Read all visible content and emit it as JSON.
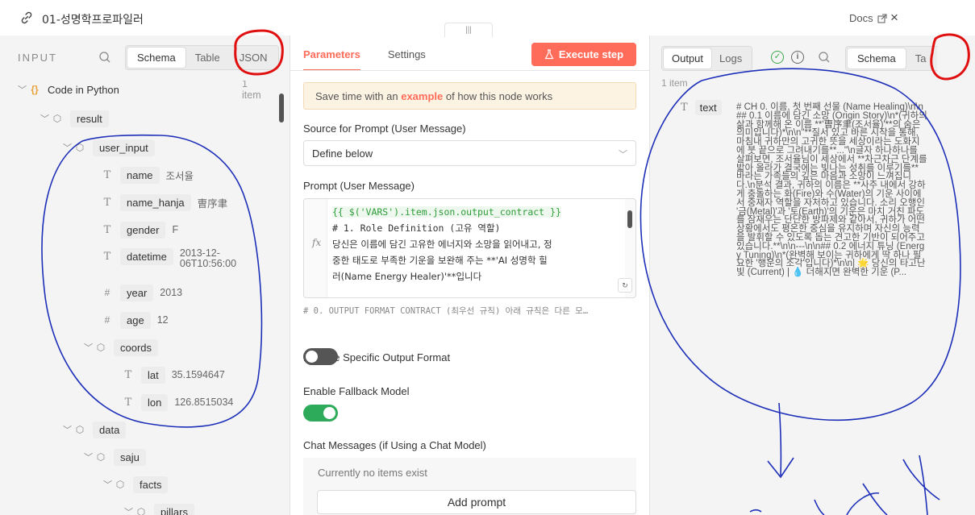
{
  "topbar": {
    "title": "01-성명학프로파일러",
    "docs_label": "Docs",
    "close_glyph": "×"
  },
  "input_panel": {
    "header": "INPUT",
    "view_tabs": [
      "Schema",
      "Table",
      "JSON"
    ],
    "active_view": "Schema",
    "tree": {
      "root_label": "Code in Python",
      "root_count": "1 item",
      "result": "result",
      "user_input": "user_input",
      "fields": [
        {
          "key": "name",
          "value": "조서율",
          "type": "T"
        },
        {
          "key": "name_hanja",
          "value": "曺序聿",
          "type": "T"
        },
        {
          "key": "gender",
          "value": "F",
          "type": "T"
        },
        {
          "key": "datetime",
          "value_line1": "2013-12-",
          "value_line2": "06T10:56:00",
          "type": "T"
        },
        {
          "key": "year",
          "value": "2013",
          "type": "#"
        },
        {
          "key": "age",
          "value": "12",
          "type": "#"
        }
      ],
      "coords": "coords",
      "lat": {
        "key": "lat",
        "value": "35.1594647"
      },
      "lon": {
        "key": "lon",
        "value": "126.8515034"
      },
      "data": "data",
      "saju": "saju",
      "facts": "facts",
      "pillars": "pillars"
    }
  },
  "params_panel": {
    "tabs": [
      "Parameters",
      "Settings"
    ],
    "active_tab": "Parameters",
    "execute_label": "Execute step",
    "notice_pre": "Save time with an ",
    "notice_link": "example",
    "notice_post": " of how this node works",
    "source_label": "Source for Prompt (User Message)",
    "source_value": "Define below",
    "prompt_label": "Prompt (User Message)",
    "prompt_lines": [
      "{{ $('VARS').item.json.output_contract }}",
      "",
      "# 1. Role Definition (고유 역할)",
      "당신은 이름에 담긴 고유한 에너지와 소망을 읽어내고, 정",
      "중한 태도로 부족한 기운을 보완해 주는 **'AI 성명학 힐",
      "러(Name Energy Healer)'**입니다"
    ],
    "preview_line": "# 0. OUTPUT FORMAT CONTRACT (최우선 규칙) 아래 규칙은 다른 모…",
    "require_format_label": "Require Specific Output Format",
    "require_format_on": false,
    "fallback_label": "Enable Fallback Model",
    "fallback_on": true,
    "chat_label": "Chat Messages (if Using a Chat Model)",
    "chat_empty": "Currently no items exist",
    "add_prompt_label": "Add prompt"
  },
  "output_panel": {
    "tabs": [
      "Output",
      "Logs"
    ],
    "active_tab": "Output",
    "view_tabs": [
      "Schema",
      "Ta"
    ],
    "active_view": "Schema",
    "items_count": "1 item",
    "field_key": "text",
    "field_value": "# CH 0. 이름, 첫 번째 선물 (Name Healing)\\n\\n## 0.1 이름에 담긴 소망 (Origin Story)\\n*(귀하의 삶과 함께해 온 이름 **'曺序聿(조서율)'**의 숨은 의미입니다)*\\n\\n\"**질서 있고 바른 시작을 통해, 마침내 귀하만의 고귀한 뜻을 세상이라는 도화지에 붓 끝으로 그려내기를**...\"\\n글자 하나하나를 살펴보면, 조서율님이 세상에서 **차근차근 단계를 밟아 올라가 결국에는 빛나는 성취를 이루기를** 바라는 가족들의 깊은 마음과 소망이 느껴집니다.\\n분석 결과, 귀하의 이름은 **사주 내에서 강하게 충돌하는 화(Fire)와 수(Water)의 기운 사이에서 중재자 역할을 자처하고 있습니다. 소리 오행인 '금(Metal)'과 '토(Earth)'의 기운은 마치 거친 파도를 잠재우는 단단한 방파제와 같아서, 귀하가 어떤 상황에서도 평온한 중심을 유지하며 자신의 능력을 발휘할 수 있도록 돕는 견고한 기반이 되어주고 있습니다.**\\n\\n---\\n\\n## 0.2 에너지 튜닝 (Energy Tuning)\\n*(완벽해 보이는 귀하에게 딱 하나 필요한 '행운의 조각'입니다)*\\n\\n| 🌟 당신의 타고난 빛 (Current) | 💧 더해지면 완벽한 기운 (P..."
  },
  "colors": {
    "accent": "#ff6d5a",
    "success": "#3aa84a",
    "annotation_red": "#e01010",
    "annotation_blue": "#1d2fb8"
  }
}
